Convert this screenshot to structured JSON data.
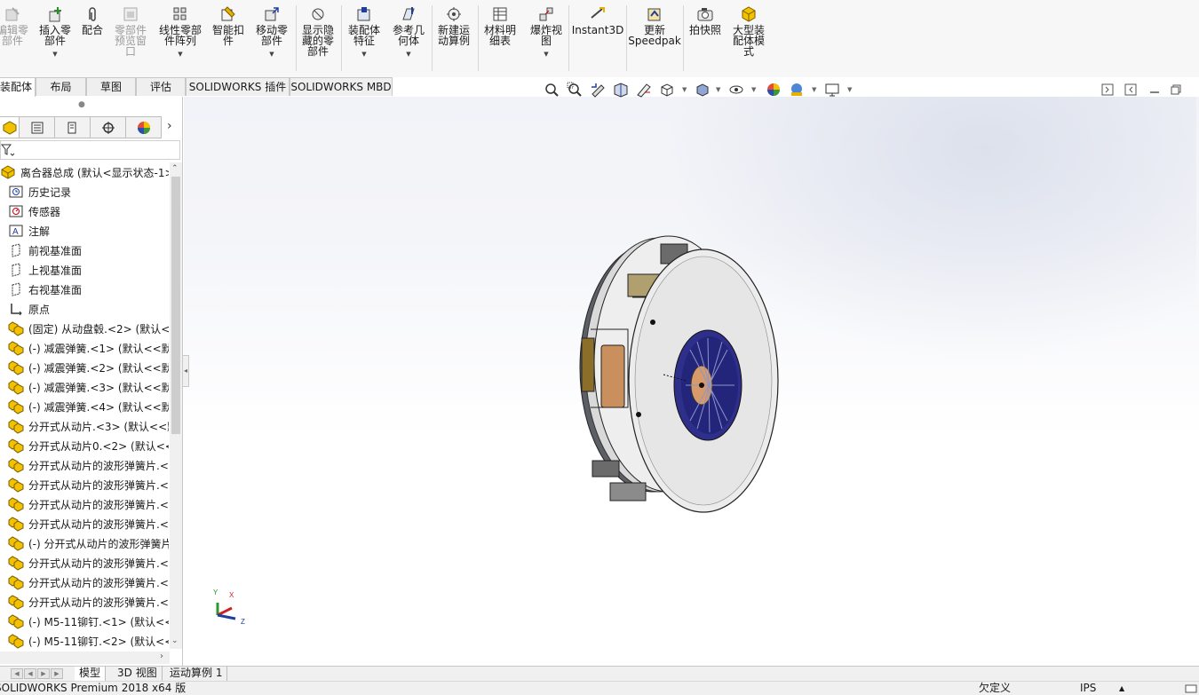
{
  "ribbon": {
    "buttons": [
      {
        "name": "edit-component",
        "label": "编辑零\n部件",
        "icon": "edit-component-icon",
        "disabled": true,
        "dropdown": false
      },
      {
        "name": "insert-component",
        "label": "插入零\n部件",
        "icon": "insert-component-icon",
        "disabled": false,
        "dropdown": true
      },
      {
        "name": "mate",
        "label": "配合",
        "icon": "paperclip-icon",
        "disabled": false,
        "dropdown": false
      },
      {
        "name": "component-preview",
        "label": "零部件\n预览窗\n口",
        "icon": "preview-window-icon",
        "disabled": true,
        "dropdown": false
      },
      {
        "name": "linear-pattern",
        "label": "线性零部\n件阵列",
        "icon": "linear-pattern-icon",
        "disabled": false,
        "dropdown": true
      },
      {
        "name": "smart-fasteners",
        "label": "智能扣\n件",
        "icon": "smart-fastener-icon",
        "disabled": false,
        "dropdown": false
      },
      {
        "name": "move-component",
        "label": "移动零\n部件",
        "icon": "move-component-icon",
        "disabled": false,
        "dropdown": true
      },
      {
        "name": "show-hidden",
        "label": "显示隐\n藏的零\n部件",
        "icon": "show-hidden-icon",
        "disabled": false,
        "dropdown": false
      },
      {
        "name": "assembly-features",
        "label": "装配体\n特征",
        "icon": "assembly-feature-icon",
        "disabled": false,
        "dropdown": true
      },
      {
        "name": "reference-geometry",
        "label": "参考几\n何体",
        "icon": "reference-geometry-icon",
        "disabled": false,
        "dropdown": true
      },
      {
        "name": "new-motion-study",
        "label": "新建运\n动算例",
        "icon": "motion-study-icon",
        "disabled": false,
        "dropdown": false
      },
      {
        "name": "bill-of-materials",
        "label": "材料明\n细表",
        "icon": "bom-icon",
        "disabled": false,
        "dropdown": false
      },
      {
        "name": "exploded-view",
        "label": "爆炸视\n图",
        "icon": "exploded-view-icon",
        "disabled": false,
        "dropdown": true
      },
      {
        "name": "instant3d",
        "label": "Instant3D",
        "icon": "instant3d-icon",
        "disabled": false,
        "dropdown": false
      },
      {
        "name": "update-speedpak",
        "label": "更新\nSpeedpak",
        "icon": "speedpak-icon",
        "disabled": false,
        "dropdown": false
      },
      {
        "name": "take-snapshot",
        "label": "拍快照",
        "icon": "camera-icon",
        "disabled": false,
        "dropdown": false
      },
      {
        "name": "large-assembly-mode",
        "label": "大型装\n配体模\n式",
        "icon": "large-assembly-icon",
        "disabled": false,
        "dropdown": false
      }
    ]
  },
  "command_tabs": [
    "装配体",
    "布局",
    "草图",
    "评估",
    "SOLIDWORKS 插件",
    "SOLIDWORKS MBD"
  ],
  "active_command_tab": 0,
  "heads_up_icons": [
    "zoom-to-fit-icon",
    "zoom-to-area-icon",
    "previous-view-icon",
    "section-view-icon",
    "dynamic-annotation-icon",
    "view-orientation-icon",
    "display-style-icon",
    "hide-show-items-icon",
    "edit-appearance-icon",
    "apply-scene-icon",
    "view-settings-icon"
  ],
  "window_controls": [
    "restore-pane-icon",
    "maximize-pane-icon",
    "minimize-icon",
    "restore-icon"
  ],
  "feature_manager": {
    "tabs": [
      "featuremanager-tree-icon",
      "property-manager-icon",
      "configuration-manager-icon",
      "dimxpert-manager-icon",
      "display-manager-icon"
    ],
    "tree": [
      {
        "label": "离合器总成  (默认<显示状态-1>)",
        "icon": "assembly-icon",
        "indent": 0
      },
      {
        "label": "历史记录",
        "icon": "history-icon",
        "indent": 1
      },
      {
        "label": "传感器",
        "icon": "sensor-icon",
        "indent": 1
      },
      {
        "label": "注解",
        "icon": "annotation-icon",
        "indent": 1
      },
      {
        "label": "前视基准面",
        "icon": "plane-icon",
        "indent": 1
      },
      {
        "label": "上视基准面",
        "icon": "plane-icon",
        "indent": 1
      },
      {
        "label": "右视基准面",
        "icon": "plane-icon",
        "indent": 1
      },
      {
        "label": "原点",
        "icon": "origin-icon",
        "indent": 1
      },
      {
        "label": "(固定) 从动盘毂.<2> (默认<<",
        "icon": "subassembly-icon",
        "indent": 1
      },
      {
        "label": "(-) 减震弹簧.<1> (默认<<默",
        "icon": "subassembly-icon",
        "indent": 1
      },
      {
        "label": "(-) 减震弹簧.<2> (默认<<默",
        "icon": "subassembly-icon",
        "indent": 1
      },
      {
        "label": "(-) 减震弹簧.<3> (默认<<默",
        "icon": "subassembly-icon",
        "indent": 1
      },
      {
        "label": "(-) 减震弹簧.<4> (默认<<默",
        "icon": "subassembly-icon",
        "indent": 1
      },
      {
        "label": "分开式从动片.<3> (默认<<默",
        "icon": "subassembly-icon",
        "indent": 1
      },
      {
        "label": "分开式从动片0.<2> (默认<<",
        "icon": "subassembly-icon",
        "indent": 1
      },
      {
        "label": "分开式从动片的波形弹簧片.<",
        "icon": "subassembly-icon",
        "indent": 1
      },
      {
        "label": "分开式从动片的波形弹簧片.<",
        "icon": "subassembly-icon",
        "indent": 1
      },
      {
        "label": "分开式从动片的波形弹簧片.<",
        "icon": "subassembly-icon",
        "indent": 1
      },
      {
        "label": "分开式从动片的波形弹簧片.<",
        "icon": "subassembly-icon",
        "indent": 1
      },
      {
        "label": "(-) 分开式从动片的波形弹簧片",
        "icon": "subassembly-icon",
        "indent": 1
      },
      {
        "label": "分开式从动片的波形弹簧片.<",
        "icon": "subassembly-icon",
        "indent": 1
      },
      {
        "label": "分开式从动片的波形弹簧片.<",
        "icon": "subassembly-icon",
        "indent": 1
      },
      {
        "label": "分开式从动片的波形弹簧片.<",
        "icon": "subassembly-icon",
        "indent": 1
      },
      {
        "label": "(-) M5-11铆钉.<1> (默认<<",
        "icon": "subassembly-icon",
        "indent": 1
      },
      {
        "label": "(-) M5-11铆钉.<2> (默认<<",
        "icon": "subassembly-icon",
        "indent": 1
      }
    ]
  },
  "bottom_tabs": [
    "模型",
    "3D 视图",
    "运动算例 1"
  ],
  "active_bottom_tab": 0,
  "status_bar": {
    "product": "SOLIDWORKS Premium 2018 x64 版",
    "state": "欠定义",
    "units": "IPS"
  },
  "triad": {
    "x": "X",
    "y": "Y",
    "z": "Z"
  },
  "colors": {
    "accent_blue": "#1f3fa0",
    "ribbon_bg": "#f7f7f7",
    "tree_icon_yellow": "#f2c200"
  }
}
